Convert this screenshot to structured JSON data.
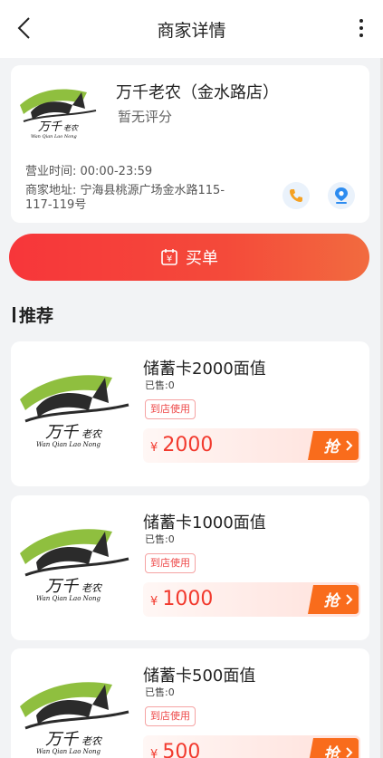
{
  "header": {
    "title": "商家详情",
    "back_icon": "back-chevron-icon",
    "more_icon": "more-vertical-icon"
  },
  "shop": {
    "name": "万千老农（金水路店）",
    "rating": "暂无评分",
    "logo_text": "万千老农",
    "logo_pinyin": "Wan Qian Lao Nong",
    "hours": "营业时间: 00:00-23:59",
    "address": "商家地址: 宁海县桃源广场金水路115-117-119号",
    "phone_icon": "phone-icon",
    "location_icon": "location-icon"
  },
  "pay_button": {
    "label": "买单",
    "icon": "yen-calendar-icon"
  },
  "section": {
    "title": "推荐"
  },
  "products": [
    {
      "name": "储蓄卡2000面值",
      "sold": "已售:0",
      "tag": "到店使用",
      "currency": "¥",
      "price": "2000",
      "grab": "抢"
    },
    {
      "name": "储蓄卡1000面值",
      "sold": "已售:0",
      "tag": "到店使用",
      "currency": "¥",
      "price": "1000",
      "grab": "抢"
    },
    {
      "name": "储蓄卡500面值",
      "sold": "已售:0",
      "tag": "到店使用",
      "currency": "¥",
      "price": "500",
      "grab": "抢"
    }
  ],
  "colors": {
    "accent_red": "#f23a2e",
    "pay_gradient_start": "#f7363a",
    "pay_gradient_end": "#f26b3f",
    "grab_orange": "#f96c1c",
    "icon_phone": "#f5a122",
    "icon_location": "#2d8cf0"
  }
}
